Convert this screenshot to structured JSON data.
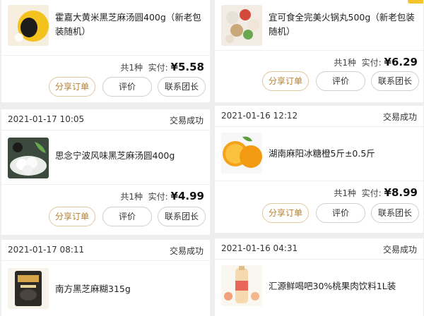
{
  "buttons": {
    "share": "分享订单",
    "review": "评价",
    "contact": "联系团长"
  },
  "labels": {
    "count_prefix": "共",
    "count_suffix": "种",
    "paid": "实付:"
  },
  "left_orders": [
    {
      "time": "",
      "status": "",
      "product": "霍嘉大黄米黑芝麻汤圆400g（新老包装随机）",
      "count": "1",
      "price": "¥5.58"
    },
    {
      "time": "2021-01-17 10:05",
      "status": "交易成功",
      "product": "思念宁波风味黑芝麻汤圆400g",
      "count": "1",
      "price": "¥4.99"
    },
    {
      "time": "2021-01-17 08:11",
      "status": "交易成功",
      "product": "南方黑芝麻糊315g",
      "count": "",
      "price": ""
    }
  ],
  "right_orders": [
    {
      "time": "",
      "status": "",
      "product": "宜可食全完美火锅丸500g（新老包装随机）",
      "count": "1",
      "price": "¥6.29"
    },
    {
      "time": "2021-01-16 12:12",
      "status": "交易成功",
      "product": "湖南麻阳冰糖橙5斤±0.5斤",
      "count": "1",
      "price": "¥8.99"
    },
    {
      "time": "2021-01-16 04:31",
      "status": "交易成功",
      "product": "汇源鲜喝吧30%桃果肉饮料1L装",
      "count": "",
      "price": ""
    }
  ],
  "icons": {
    "left_0": "tangyuan-product-image",
    "left_1": "sesame-tangyuan-product-image",
    "left_2": "sesame-paste-product-image",
    "right_0": "hotpot-balls-product-image",
    "right_1": "orange-product-image",
    "right_2": "peach-juice-product-image"
  },
  "colors": {
    "price": "#111111",
    "share_border": "#e0c7a3",
    "share_text": "#b58034",
    "accent": "#f5c32c"
  }
}
